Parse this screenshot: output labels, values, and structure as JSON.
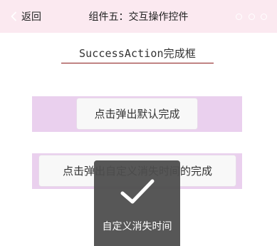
{
  "header": {
    "back_label": "返回",
    "title": "组件五：交互操作控件",
    "back_icon": "chevron-left-icon",
    "more_icon": "more-dots-icon"
  },
  "section": {
    "title": "SuccessAction完成框"
  },
  "buttons": {
    "default_complete": "点击弹出默认完成",
    "custom_timeout_complete": "点击弹出自定义消失时间的完成"
  },
  "toast": {
    "icon": "checkmark-icon",
    "message": "自定义消失时间"
  },
  "colors": {
    "header_bg": "#fbe9f0",
    "button_strip_bg": "#ead0ee",
    "title_underline": "#8b1a1a",
    "toast_bg": "#4c4c4c"
  }
}
